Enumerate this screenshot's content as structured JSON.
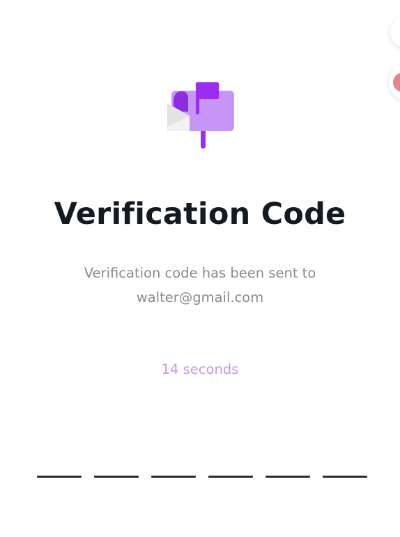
{
  "header": {
    "icon": "mailbox-icon"
  },
  "title": "Verification Code",
  "subtitle": {
    "line1": "Verification code has been sent to",
    "line2": "walter@gmail.com"
  },
  "timer": {
    "text": "14 seconds"
  },
  "code": {
    "digits": [
      "",
      "",
      "",
      "",
      "",
      ""
    ]
  },
  "colors": {
    "title": "#141a22",
    "subtitle": "#8a8a8a",
    "accent": "#c596f6",
    "mailbox_body": "#c596f6",
    "mailbox_dark": "#9b2cf0",
    "code_slot": "#2b2b2b"
  }
}
